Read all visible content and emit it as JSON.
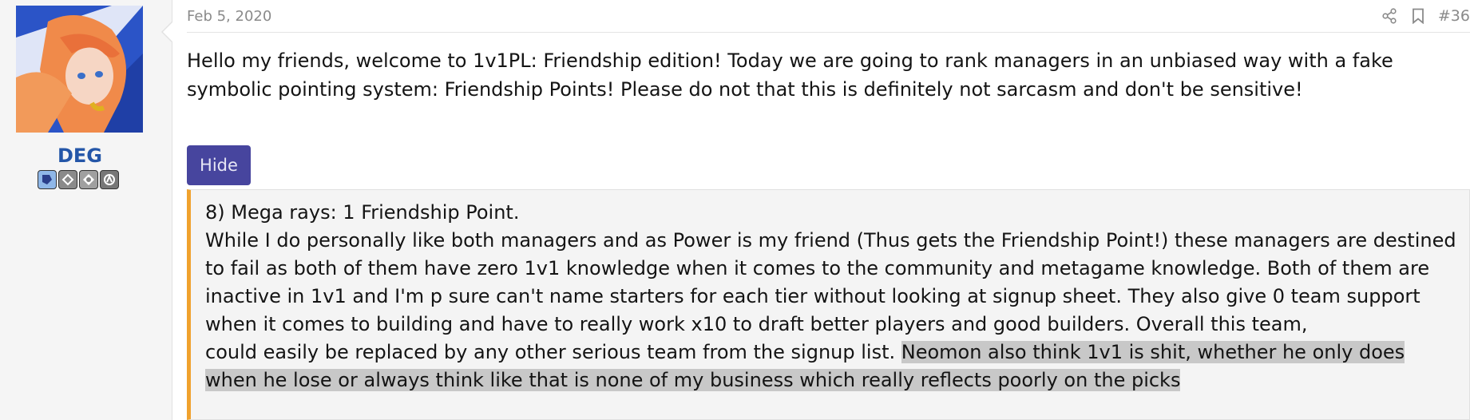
{
  "user": {
    "name": "DEG",
    "badges": [
      "badge-1-icon",
      "badge-2-icon",
      "badge-3-icon",
      "badge-4-icon"
    ]
  },
  "post": {
    "date": "Feb 5, 2020",
    "number": "#36",
    "body": "Hello my friends, welcome to 1v1PL: Friendship edition! Today we are going to rank managers in an unbiased way with a fake symbolic pointing system: Friendship Points! Please do not that this is definitely not sarcasm and don't be sensitive!",
    "hide_label": "Hide"
  },
  "spoiler": {
    "heading": "8) Mega rays: 1 Friendship Point.",
    "paragraph_1": "While I do personally like both managers and as Power is my friend (Thus gets the Friendship Point!) these managers are destined to fail as both of them have zero 1v1 knowledge when it comes to the community and metagame knowledge. Both of them are inactive in 1v1 and I'm p sure can't name starters for each tier without looking at signup sheet. They also give 0 team support when it comes to building and have to really work x10 to draft better players and good builders. Overall this team,",
    "paragraph_2_plain": "could easily be replaced by any other serious team from the signup list. ",
    "paragraph_2_highlight": "Neomon also think 1v1 is shit, whether he only does when he lose or always think like that is none of my business which really reflects poorly on the picks"
  },
  "colors": {
    "accent_button": "#47459e",
    "spoiler_border": "#f0a22e",
    "username": "#2456a8",
    "highlight": "#c8c8c8"
  }
}
